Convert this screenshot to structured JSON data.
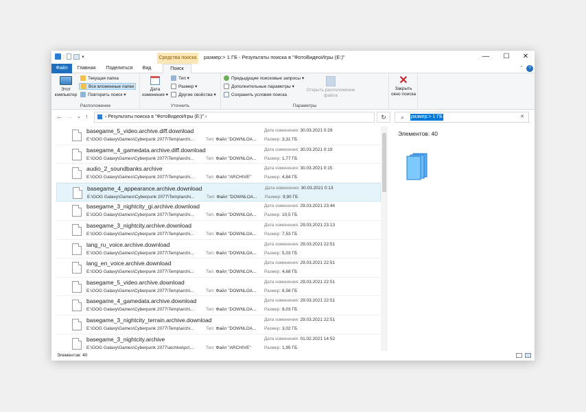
{
  "window": {
    "context_tab": "Средства поиска",
    "title": "размер:> 1 ГБ - Результаты поиска в \"ФотоВидеоИгры (E:)\"",
    "minimize": "—",
    "maximize": "☐",
    "close": "✕",
    "qa_separator": "|",
    "qa_dropdown": "▾"
  },
  "tabs": {
    "file": "Файл",
    "home": "Главная",
    "share": "Поделиться",
    "view": "Вид",
    "search": "Поиск",
    "collapse": "⌃",
    "help": "?"
  },
  "ribbon": {
    "this_pc": "Этот компьютер",
    "current_folder": "Текущая папка",
    "all_subfolders": "Все вложенные папки",
    "search_again": "Повторить поиск ▾",
    "group_location": "Расположение",
    "date_modified": "Дата изменения ▾",
    "type": "Тип ▾",
    "size": "Размер ▾",
    "other_props": "Другие свойства ▾",
    "group_refine": "Уточнить",
    "recent_searches": "Предыдущие поисковые запросы ▾",
    "advanced_options": "Дополнительные параметры ▾",
    "save_search": "Сохранить условия поиска",
    "open_location": "Открыть расположение файла",
    "group_options": "Параметры",
    "close_search": "Закрыть окно поиска"
  },
  "address": {
    "back": "←",
    "forward": "→",
    "dropdown": "⌄",
    "up": "↑",
    "path": "›  Результаты поиска в \"ФотоВидеоИгры (E:)\"  ›",
    "refresh": "↻",
    "search_icon": "⌕",
    "search_query": "размер:> 1 ГБ",
    "search_clear": "✕"
  },
  "labels": {
    "date": "Дата изменения:",
    "size": "Размер:",
    "type": "Тип:"
  },
  "files": [
    {
      "name": "basegame_5_video.archive.diff.download",
      "path": "E:\\GOG Galaxy\\Games\\Cyberpunk 2077\\Temp\\archi...",
      "type": "Файл \"DOWNLOA...",
      "date": "30.03.2021 0:29",
      "size": "3,31 ГБ"
    },
    {
      "name": "basegame_4_gamedata.archive.diff.download",
      "path": "E:\\GOG Galaxy\\Games\\Cyberpunk 2077\\Temp\\archi...",
      "type": "Файл \"DOWNLOA...",
      "date": "30.03.2021 0:19",
      "size": "1,77 ГБ"
    },
    {
      "name": "audio_2_soundbanks.archive",
      "path": "E:\\GOG Galaxy\\Games\\Cyberpunk 2077\\Temp\\archi...",
      "type": "Файл \"ARCHIVE\"",
      "date": "30.03.2021 0:15",
      "size": "4,84 ГБ"
    },
    {
      "name": "basegame_4_appearance.archive.download",
      "path": "E:\\GOG Galaxy\\Games\\Cyberpunk 2077\\Temp\\archi...",
      "type": "Файл \"DOWNLOA...",
      "date": "30.03.2021 0:13",
      "size": "9,90 ГБ"
    },
    {
      "name": "basegame_3_nightcity_gi.archive.download",
      "path": "E:\\GOG Galaxy\\Games\\Cyberpunk 2077\\Temp\\archi...",
      "type": "Файл \"DOWNLOA...",
      "date": "29.03.2021 23:44",
      "size": "10,5 ГБ"
    },
    {
      "name": "basegame_3_nightcity.archive.download",
      "path": "E:\\GOG Galaxy\\Games\\Cyberpunk 2077\\Temp\\archi...",
      "type": "Файл \"DOWNLOA...",
      "date": "29.03.2021 23:13",
      "size": "7,53 ГБ"
    },
    {
      "name": "lang_ru_voice.archive.download",
      "path": "E:\\GOG Galaxy\\Games\\Cyberpunk 2077\\Temp\\archi...",
      "type": "Файл \"DOWNLOA...",
      "date": "29.03.2021 22:51",
      "size": "5,03 ГБ"
    },
    {
      "name": "lang_en_voice.archive.download",
      "path": "E:\\GOG Galaxy\\Games\\Cyberpunk 2077\\Temp\\archi...",
      "type": "Файл \"DOWNLOA...",
      "date": "29.03.2021 22:51",
      "size": "4,68 ГБ"
    },
    {
      "name": "basegame_5_video.archive.download",
      "path": "E:\\GOG Galaxy\\Games\\Cyberpunk 2077\\Temp\\archi...",
      "type": "Файл \"DOWNLOA...",
      "date": "29.03.2021 22:51",
      "size": "8,58 ГБ"
    },
    {
      "name": "basegame_4_gamedata.archive.download",
      "path": "E:\\GOG Galaxy\\Games\\Cyberpunk 2077\\Temp\\archi...",
      "type": "Файл \"DOWNLOA...",
      "date": "29.03.2021 22:51",
      "size": "8,03 ГБ"
    },
    {
      "name": "basegame_3_nightcity_terrain.archive.download",
      "path": "E:\\GOG Galaxy\\Games\\Cyberpunk 2077\\Temp\\archi...",
      "type": "Файл \"DOWNLOA...",
      "date": "29.03.2021 22:51",
      "size": "3,02 ГБ"
    },
    {
      "name": "basegame_3_nightcity.archive",
      "path": "E:\\GOG Galaxy\\Games\\Cyberpunk 2077\\archive\\pc\\...",
      "type": "Файл \"ARCHIVE\"",
      "date": "01.02.2021 14:52",
      "size": "1,95 ГБ"
    }
  ],
  "selected_row": 3,
  "preview": {
    "count": "Элементов: 40"
  },
  "status": {
    "count": "Элементов: 40"
  }
}
